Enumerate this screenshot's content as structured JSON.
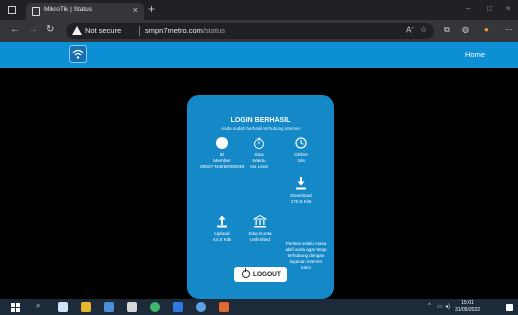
{
  "browser": {
    "tab_title": "MikroTik | Status",
    "tab_close": "×",
    "new_tab": "+",
    "security_label": "Not secure",
    "url_host": "smpn7metro.com",
    "url_path": "/status",
    "nav": {
      "back": "←",
      "forward": "→",
      "refresh": "↻"
    },
    "window": {
      "minimize": "–",
      "maximize": "□",
      "close": "×"
    }
  },
  "site": {
    "home_label": "Home",
    "logo_icon": "wifi-router-icon",
    "header_color": "#0d8fd6"
  },
  "card": {
    "title": "LOGIN BERHASIL",
    "subtitle": "Anda sudah berhasil terhubung internet",
    "id_member": {
      "label1": "ID",
      "label2": "Member",
      "value": "29527-N4tr8r000048"
    },
    "sisa_waktu": {
      "label1": "Sisa",
      "label2": "Waktu",
      "value": "No Limit"
    },
    "online": {
      "label1": "Online",
      "value": "16s"
    },
    "download": {
      "label1": "Download",
      "value": "170.8 KiB"
    },
    "upload": {
      "label1": "Upload",
      "value": "44.0 KiB"
    },
    "sisa_kuota": {
      "label1": "Sisa Kuota",
      "value": "Unlimited"
    },
    "note": "Periksa selalu masa aktif anda agar tetap terhubung dengan layanan internet kami",
    "logout_label": "LOGOUT",
    "card_color": "#1589c7"
  },
  "taskbar": {
    "time": "15:01",
    "date": "31/05/2022",
    "tray_arrow": "^"
  }
}
